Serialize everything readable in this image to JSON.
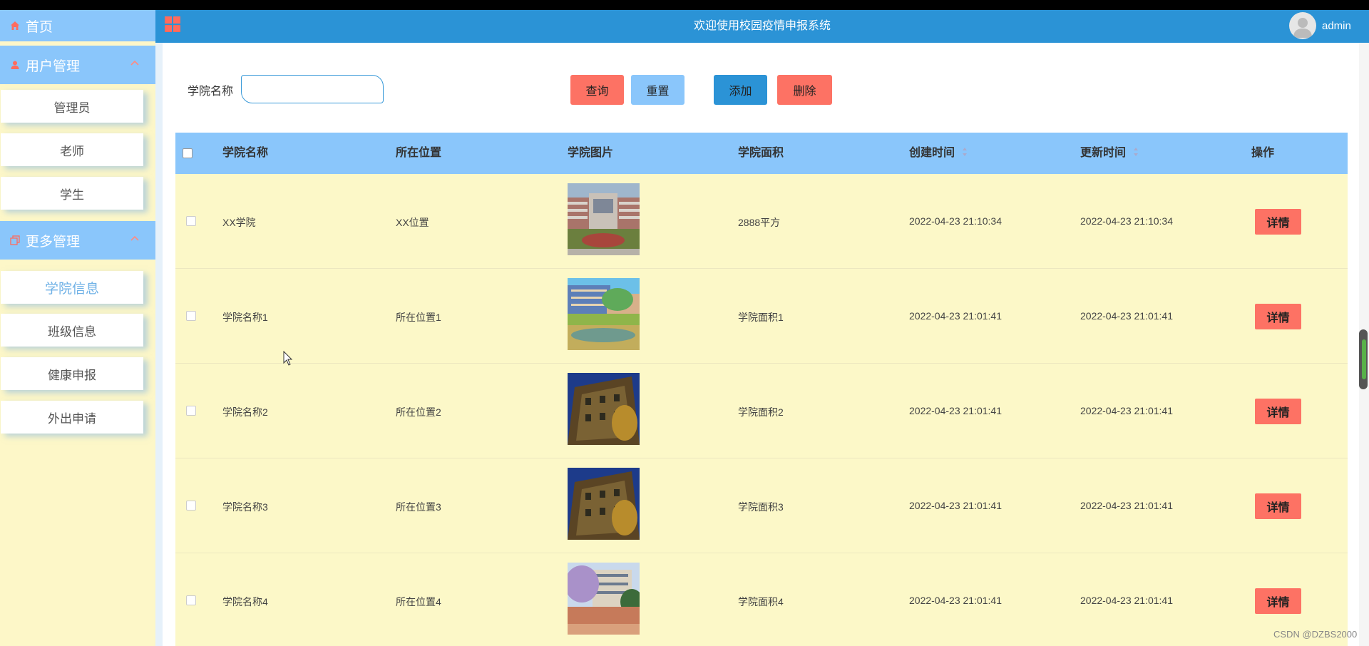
{
  "header": {
    "title": "欢迎使用校园疫情申报系统",
    "username": "admin"
  },
  "sidebar": {
    "home_label": "首页",
    "groups": [
      {
        "label": "用户管理",
        "items": [
          "管理员",
          "老师",
          "学生"
        ]
      },
      {
        "label": "更多管理",
        "items": [
          "学院信息",
          "班级信息",
          "健康申报",
          "外出申请"
        ]
      }
    ],
    "active_item": "学院信息"
  },
  "filter": {
    "label": "学院名称",
    "value": "",
    "buttons": {
      "query": "查询",
      "reset": "重置",
      "add": "添加",
      "delete": "删除"
    }
  },
  "table": {
    "columns": [
      "学院名称",
      "所在位置",
      "学院图片",
      "学院面积",
      "创建时间",
      "更新时间",
      "操作"
    ],
    "rows": [
      {
        "name": "XX学院",
        "location": "XX位置",
        "area": "2888平方",
        "created": "2022-04-23 21:10:34",
        "updated": "2022-04-23 21:10:34",
        "action": "详情",
        "image": "campus-building-photo"
      },
      {
        "name": "学院名称1",
        "location": "所在位置1",
        "area": "学院面积1",
        "created": "2022-04-23 21:01:41",
        "updated": "2022-04-23 21:01:41",
        "action": "详情",
        "image": "campus-lake-photo"
      },
      {
        "name": "学院名称2",
        "location": "所在位置2",
        "area": "学院面积2",
        "created": "2022-04-23 21:01:41",
        "updated": "2022-04-23 21:01:41",
        "action": "详情",
        "image": "ivy-building-photo"
      },
      {
        "name": "学院名称3",
        "location": "所在位置3",
        "area": "学院面积3",
        "created": "2022-04-23 21:01:41",
        "updated": "2022-04-23 21:01:41",
        "action": "详情",
        "image": "ivy-building-photo"
      },
      {
        "name": "学院名称4",
        "location": "所在位置4",
        "area": "学院面积4",
        "created": "2022-04-23 21:01:41",
        "updated": "2022-04-23 21:01:41",
        "action": "详情",
        "image": "cherry-blossom-building-photo"
      }
    ]
  },
  "watermark": "CSDN @DZBS2000",
  "colors": {
    "sidebar_blue": "#8ac6fb",
    "header_blue": "#2b93d6",
    "accent_red": "#fd7264",
    "row_yellow": "#fcf8c8",
    "active_text": "#6fb1e6"
  }
}
